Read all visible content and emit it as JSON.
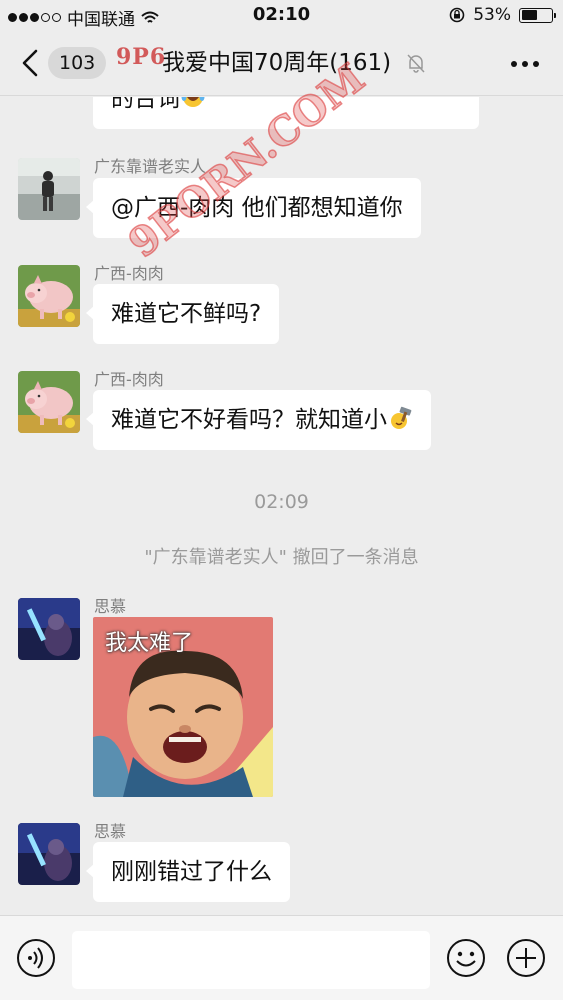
{
  "status_bar": {
    "carrier": "中国联通",
    "time": "02:10",
    "battery_percent": "53%",
    "battery_level": 0.53
  },
  "nav": {
    "unread_count": "103",
    "title": "我爱中国70周年(161)"
  },
  "messages": [
    {
      "type": "text",
      "text": "的台词",
      "trailing_emoji": "laughing-tears-emoji"
    },
    {
      "type": "text",
      "sender": "广东靠谱老实人",
      "text": "@广西-肉肉 他们都想知道你"
    },
    {
      "type": "text",
      "sender": "广西-肉肉",
      "text": "难道它不鲜吗?"
    },
    {
      "type": "text",
      "sender": "广西-肉肉",
      "text": "难道它不好看吗？就知道小",
      "trailing_emoji": "hammer-emoji"
    },
    {
      "type": "time",
      "text": "02:09"
    },
    {
      "type": "system",
      "text": "\"广东靠谱老实人\" 撤回了一条消息"
    },
    {
      "type": "sticker",
      "sender": "思慕",
      "caption": "我太难了"
    },
    {
      "type": "text",
      "sender": "思慕",
      "text": "刚刚错过了什么"
    }
  ],
  "watermark": {
    "top": "9P6",
    "diagonal": "9PORN.COM"
  },
  "input_bar": {
    "placeholder": ""
  },
  "colors": {
    "background": "#ededed",
    "bubble": "#ffffff",
    "meta_text": "#9a9a9a"
  }
}
